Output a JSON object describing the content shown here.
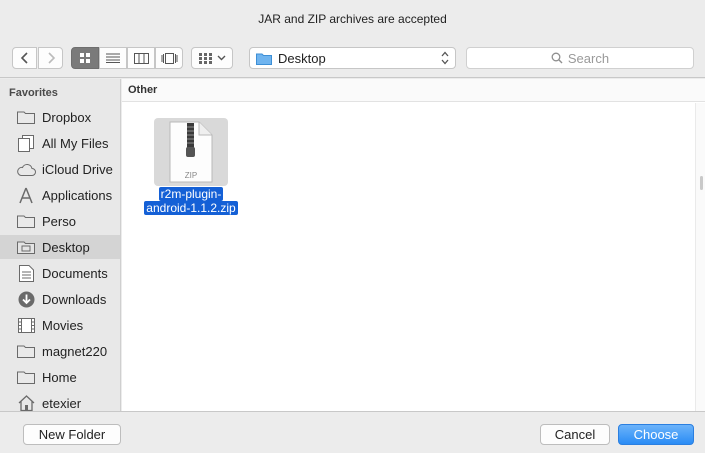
{
  "title": "JAR and ZIP archives are accepted",
  "toolbar": {
    "location": "Desktop",
    "search_placeholder": "Search"
  },
  "sidebar": {
    "header": "Favorites",
    "items": [
      {
        "label": "Dropbox",
        "icon": "folder-icon"
      },
      {
        "label": "All My Files",
        "icon": "all-files-icon"
      },
      {
        "label": "iCloud Drive",
        "icon": "cloud-icon"
      },
      {
        "label": "Applications",
        "icon": "applications-icon"
      },
      {
        "label": "Perso",
        "icon": "folder-icon"
      },
      {
        "label": "Desktop",
        "icon": "desktop-icon",
        "active": true
      },
      {
        "label": "Documents",
        "icon": "documents-icon"
      },
      {
        "label": "Downloads",
        "icon": "downloads-icon"
      },
      {
        "label": "Movies",
        "icon": "movies-icon"
      },
      {
        "label": "magnet220",
        "icon": "folder-icon"
      },
      {
        "label": "Home",
        "icon": "folder-icon"
      },
      {
        "label": "etexier",
        "icon": "home-icon"
      }
    ]
  },
  "main": {
    "group_header": "Other",
    "files": [
      {
        "name_line1": "r2m-plugin-",
        "name_line2": "android-1.1.2.zip",
        "type_label": "ZIP",
        "selected": true
      }
    ]
  },
  "buttons": {
    "new_folder": "New Folder",
    "cancel": "Cancel",
    "choose": "Choose"
  },
  "colors": {
    "accent": "#2a8cf5",
    "selection": "#1460d6"
  }
}
